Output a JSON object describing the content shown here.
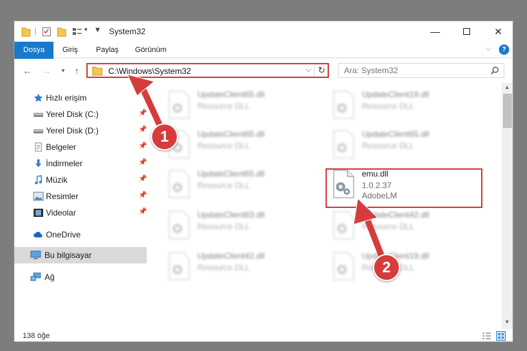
{
  "window": {
    "title": "System32"
  },
  "ribbon": {
    "tabs": [
      "Dosya",
      "Giriş",
      "Paylaş",
      "Görünüm"
    ]
  },
  "address": {
    "path": "C:\\Windows\\System32"
  },
  "search": {
    "placeholder": "Ara: System32"
  },
  "navpane": {
    "items": [
      {
        "label": "Hızlı erişim",
        "icon": "star-icon"
      },
      {
        "label": "Yerel Disk (C:)",
        "icon": "drive-icon"
      },
      {
        "label": "Yerel Disk (D:)",
        "icon": "drive-icon"
      },
      {
        "label": "Belgeler",
        "icon": "document-icon"
      },
      {
        "label": "İndirmeler",
        "icon": "download-icon"
      },
      {
        "label": "Müzik",
        "icon": "music-icon"
      },
      {
        "label": "Resimler",
        "icon": "pictures-icon"
      },
      {
        "label": "Videolar",
        "icon": "video-icon"
      },
      {
        "label": "OneDrive",
        "icon": "cloud-icon"
      },
      {
        "label": "Bu bilgisayar",
        "icon": "computer-icon"
      },
      {
        "label": "Ağ",
        "icon": "network-icon"
      }
    ]
  },
  "files": [
    {
      "name": "UpdateClient65.dll",
      "meta1": "Resource DLL",
      "meta2": ""
    },
    {
      "name": "UpdateClient19.dll",
      "meta1": "Resource DLL",
      "meta2": ""
    },
    {
      "name": "UpdateClient65.dll",
      "meta1": "Resource DLL",
      "meta2": ""
    },
    {
      "name": "UpdateClient65.dll",
      "meta1": "Resource DLL",
      "meta2": ""
    },
    {
      "name": "UpdateClient65.dll",
      "meta1": "Resource DLL",
      "meta2": ""
    },
    {
      "name": "emu.dll",
      "meta1": "1.0.2.37",
      "meta2": "AdobeLM"
    },
    {
      "name": "UpdateClient63.dll",
      "meta1": "Resource DLL",
      "meta2": ""
    },
    {
      "name": "UpdateClient42.dll",
      "meta1": "Resource DLL",
      "meta2": ""
    },
    {
      "name": "UpdateClient42.dll",
      "meta1": "Resource DLL",
      "meta2": ""
    },
    {
      "name": "UpdateClient19.dll",
      "meta1": "Resource DLL",
      "meta2": ""
    }
  ],
  "status": {
    "count": "138 öğe"
  },
  "annotations": {
    "step1": "1",
    "step2": "2"
  },
  "colors": {
    "accent": "#1979ca",
    "highlight": "#d63c3c"
  }
}
